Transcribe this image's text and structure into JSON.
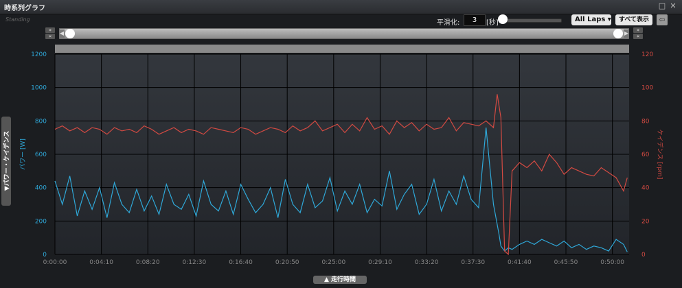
{
  "window": {
    "title": "時系列グラフ",
    "logo_text": "Standing"
  },
  "toolbar": {
    "smoothing_label": "平滑化:",
    "smoothing_value": "3",
    "smoothing_unit": "[秒]",
    "laps_label": "All Laps",
    "show_all_label": "すべて表示"
  },
  "side_tab_label": "▼パワー・ケイデンス",
  "bottom_tab_label": "▲ 走行時間",
  "colors": {
    "power": "#2fa8d8",
    "cadence": "#d34a42",
    "grid": "#000000"
  },
  "chart_data": {
    "type": "line",
    "xlabel": "",
    "x_ticks": [
      "0:00:00",
      "0:04:10",
      "0:08:20",
      "0:12:30",
      "0:16:40",
      "0:20:50",
      "0:25:00",
      "0:29:10",
      "0:33:20",
      "0:37:30",
      "0:41:40",
      "0:45:50",
      "0:50:00"
    ],
    "x_tick_seconds": [
      0,
      250,
      500,
      750,
      1000,
      1250,
      1500,
      1750,
      2000,
      2250,
      2500,
      2750,
      3000
    ],
    "xlim_seconds": [
      0,
      3090
    ],
    "y_left": {
      "label": "パワー [W]",
      "ylim": [
        0,
        1200
      ],
      "ticks": [
        "0",
        "200",
        "400",
        "600",
        "800",
        "1000",
        "1200"
      ]
    },
    "y_right": {
      "label": "ケイデンス [rpm]",
      "ylim": [
        0,
        120
      ],
      "ticks": [
        "0",
        "20",
        "40",
        "60",
        "80",
        "100",
        "120"
      ]
    },
    "grid": true,
    "series": [
      {
        "name": "パワー",
        "axis": "left",
        "x": [
          0,
          40,
          80,
          120,
          160,
          200,
          240,
          280,
          320,
          360,
          400,
          440,
          480,
          520,
          560,
          600,
          640,
          680,
          720,
          760,
          800,
          840,
          880,
          920,
          960,
          1000,
          1040,
          1080,
          1120,
          1160,
          1200,
          1240,
          1280,
          1320,
          1360,
          1400,
          1440,
          1480,
          1520,
          1560,
          1600,
          1640,
          1680,
          1720,
          1760,
          1800,
          1840,
          1880,
          1920,
          1960,
          2000,
          2040,
          2080,
          2120,
          2160,
          2200,
          2240,
          2280,
          2320,
          2360,
          2390,
          2400,
          2420,
          2440,
          2460,
          2500,
          2540,
          2580,
          2620,
          2660,
          2700,
          2740,
          2780,
          2820,
          2860,
          2900,
          2940,
          2980,
          3020,
          3060,
          3080
        ],
        "values": [
          440,
          300,
          470,
          230,
          380,
          270,
          400,
          220,
          430,
          300,
          250,
          390,
          260,
          350,
          240,
          420,
          300,
          270,
          360,
          230,
          440,
          300,
          260,
          380,
          240,
          420,
          330,
          250,
          300,
          400,
          220,
          450,
          300,
          250,
          420,
          280,
          320,
          460,
          260,
          380,
          300,
          420,
          250,
          330,
          290,
          500,
          270,
          360,
          420,
          240,
          300,
          450,
          260,
          380,
          300,
          470,
          330,
          280,
          760,
          300,
          120,
          50,
          20,
          40,
          30,
          60,
          80,
          60,
          90,
          70,
          50,
          80,
          40,
          60,
          30,
          50,
          40,
          20,
          90,
          60,
          15
        ]
      },
      {
        "name": "ケイデンス",
        "axis": "right",
        "x": [
          0,
          40,
          80,
          120,
          160,
          200,
          240,
          280,
          320,
          360,
          400,
          440,
          480,
          520,
          560,
          600,
          640,
          680,
          720,
          760,
          800,
          840,
          880,
          920,
          960,
          1000,
          1040,
          1080,
          1120,
          1160,
          1200,
          1240,
          1280,
          1320,
          1360,
          1400,
          1440,
          1480,
          1520,
          1560,
          1600,
          1640,
          1680,
          1720,
          1760,
          1800,
          1840,
          1880,
          1920,
          1960,
          2000,
          2040,
          2080,
          2120,
          2160,
          2200,
          2240,
          2280,
          2320,
          2360,
          2380,
          2400,
          2420,
          2440,
          2460,
          2500,
          2540,
          2580,
          2620,
          2660,
          2700,
          2740,
          2780,
          2820,
          2860,
          2900,
          2940,
          2980,
          3020,
          3060,
          3080
        ],
        "values": [
          75,
          77,
          74,
          76,
          73,
          76,
          75,
          72,
          76,
          74,
          75,
          73,
          77,
          75,
          72,
          74,
          76,
          73,
          75,
          74,
          72,
          76,
          75,
          74,
          73,
          76,
          75,
          72,
          74,
          76,
          75,
          73,
          77,
          74,
          76,
          80,
          74,
          76,
          78,
          73,
          78,
          74,
          82,
          75,
          77,
          72,
          80,
          76,
          79,
          74,
          78,
          75,
          76,
          82,
          74,
          79,
          78,
          77,
          80,
          76,
          96,
          82,
          2,
          0,
          50,
          55,
          52,
          56,
          50,
          60,
          55,
          48,
          52,
          50,
          48,
          47,
          52,
          49,
          46,
          38,
          46
        ]
      }
    ]
  }
}
